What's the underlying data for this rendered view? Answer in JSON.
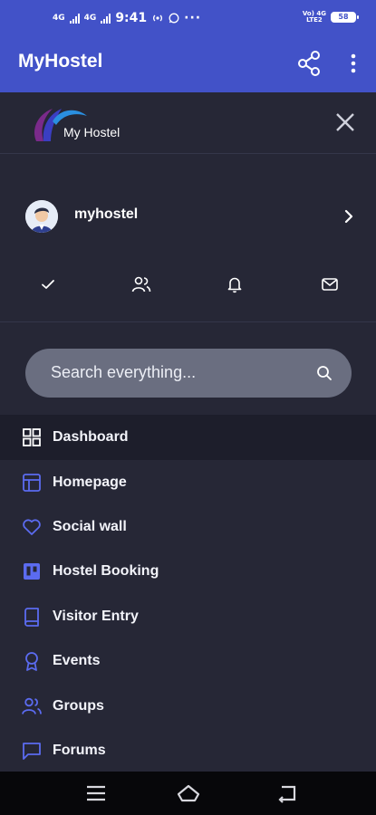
{
  "status_bar": {
    "network_left_1": "4G",
    "network_left_2": "4G",
    "time": "9:41",
    "network_right_top": "Vo) 4G",
    "network_right_bottom": "LTE2",
    "battery": "58"
  },
  "app_bar": {
    "title": "MyHostel",
    "share_icon": "share-icon",
    "more_icon": "more-vert-icon"
  },
  "drawer": {
    "logo_text": "My Hostel",
    "close_icon": "close-icon",
    "profile": {
      "username": "myhostel"
    },
    "quick_actions": [
      {
        "icon": "check-icon"
      },
      {
        "icon": "users-icon"
      },
      {
        "icon": "bell-icon"
      },
      {
        "icon": "mail-icon"
      }
    ],
    "search": {
      "placeholder": "Search everything..."
    },
    "menu": [
      {
        "label": "Dashboard",
        "icon": "grid-icon",
        "active": true
      },
      {
        "label": "Homepage",
        "icon": "layout-icon",
        "active": false
      },
      {
        "label": "Social wall",
        "icon": "heart-icon",
        "active": false
      },
      {
        "label": "Hostel Booking",
        "icon": "trello-icon",
        "active": false
      },
      {
        "label": "Visitor Entry",
        "icon": "book-icon",
        "active": false
      },
      {
        "label": "Events",
        "icon": "award-icon",
        "active": false
      },
      {
        "label": "Groups",
        "icon": "users-icon",
        "active": false
      },
      {
        "label": "Forums",
        "icon": "message-square-icon",
        "active": false
      }
    ]
  },
  "colors": {
    "app_bar": "#4252c8",
    "drawer_bg": "#262736",
    "accent": "#5b6bf0",
    "search_bg": "#6a6e80"
  }
}
